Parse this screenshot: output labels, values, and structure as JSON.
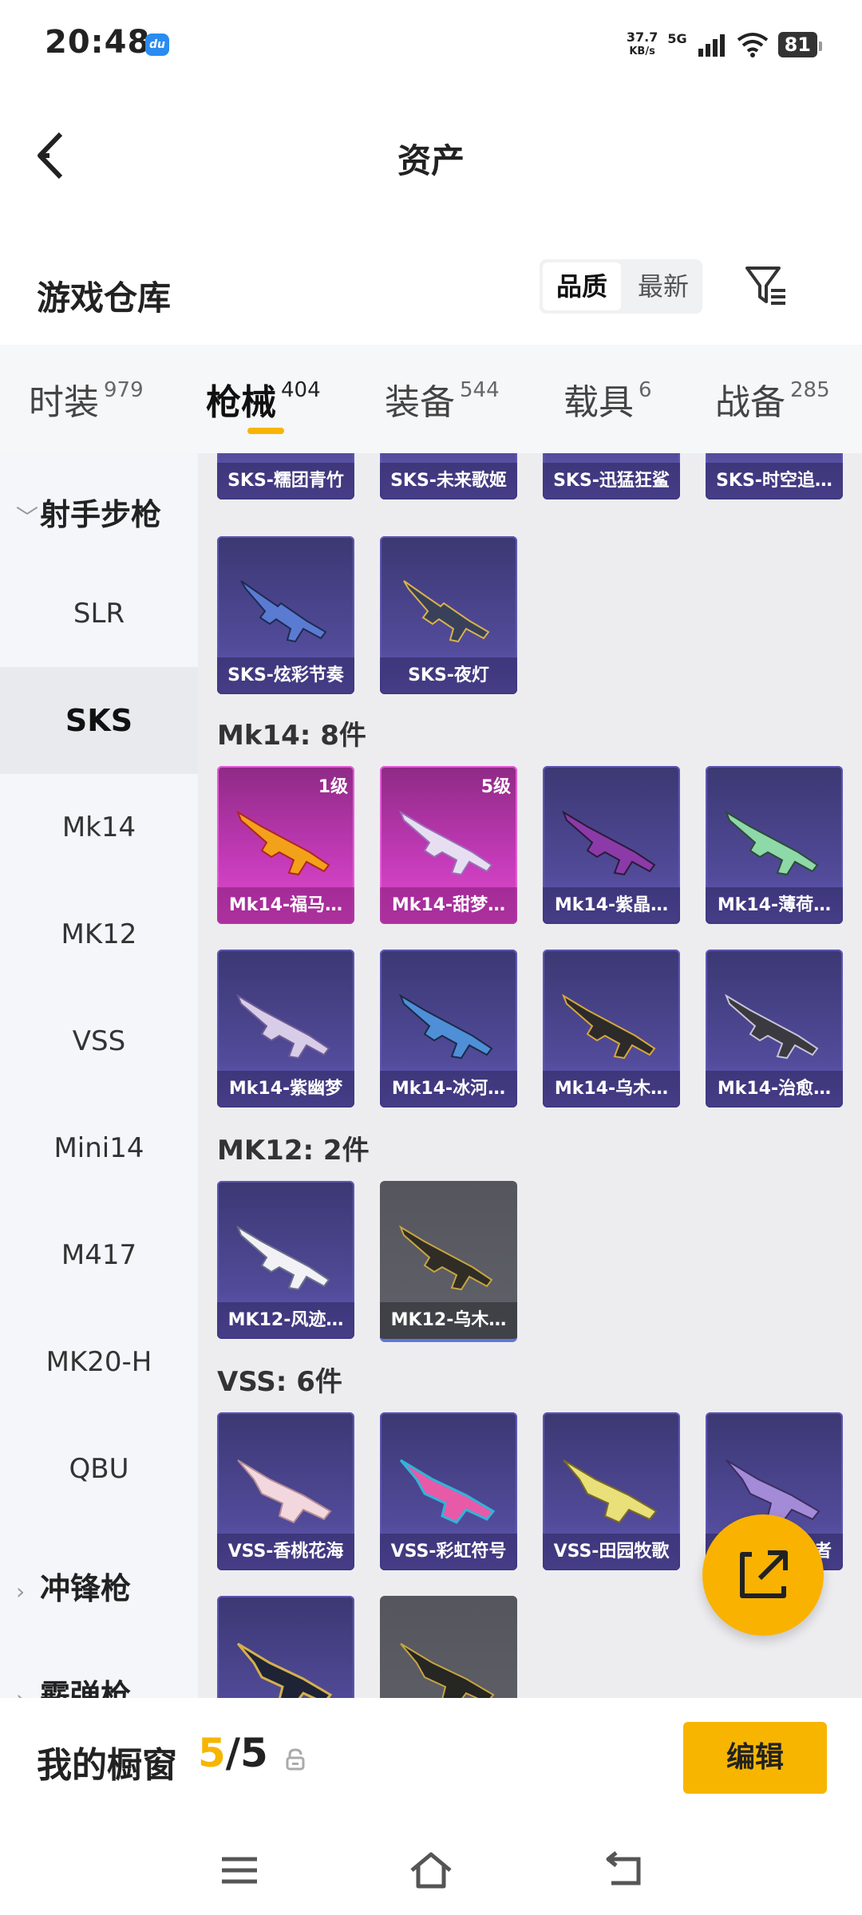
{
  "status_bar": {
    "time": "20:48",
    "app_badge": "du",
    "net_speed_value": "37.7",
    "net_speed_unit": "KB/s",
    "network": "5G",
    "battery": "81"
  },
  "header": {
    "title": "资产"
  },
  "warehouse": {
    "title": "游戏仓库",
    "sort_options": [
      "品质",
      "最新"
    ],
    "sort_selected": "品质"
  },
  "tabs": [
    {
      "label": "时装",
      "count": "979"
    },
    {
      "label": "枪械",
      "count": "404",
      "active": true
    },
    {
      "label": "装备",
      "count": "544"
    },
    {
      "label": "载具",
      "count": "6"
    },
    {
      "label": "战备",
      "count": "285"
    }
  ],
  "sidebar": {
    "group_rifle": "射手步枪",
    "items": [
      "SLR",
      "SKS",
      "Mk14",
      "MK12",
      "VSS",
      "Mini14",
      "M417",
      "MK20-H",
      "QBU"
    ],
    "selected": "SKS",
    "group_smg": "冲锋枪",
    "group_shotgun": "霰弹枪"
  },
  "content": {
    "sks_row1": [
      "SKS-糯团青竹",
      "SKS-未来歌姬",
      "SKS-迅猛狂鲨",
      "SKS-时空追…"
    ],
    "sks_row2": [
      "SKS-炫彩节奏",
      "SKS-夜灯"
    ],
    "mk14_label": "Mk14: 8件",
    "mk14_items": [
      {
        "name": "Mk14-福马…",
        "level": "1级",
        "rarity": "pink"
      },
      {
        "name": "Mk14-甜梦…",
        "level": "5级",
        "rarity": "pink"
      },
      {
        "name": "Mk14-紫晶…",
        "rarity": "purple"
      },
      {
        "name": "Mk14-薄荷…",
        "rarity": "purple"
      },
      {
        "name": "Mk14-紫幽梦",
        "rarity": "purple"
      },
      {
        "name": "Mk14-冰河…",
        "rarity": "purple"
      },
      {
        "name": "Mk14-乌木…",
        "rarity": "purple"
      },
      {
        "name": "Mk14-治愈…",
        "rarity": "purple"
      }
    ],
    "mk12_label": "MK12: 2件",
    "mk12_items": [
      {
        "name": "MK12-风迹…",
        "rarity": "purple"
      },
      {
        "name": "MK12-乌木…",
        "rarity": "gray"
      }
    ],
    "vss_label": "VSS: 6件",
    "vss_items": [
      {
        "name": "VSS-香桃花海",
        "rarity": "purple"
      },
      {
        "name": "VSS-彩虹符号",
        "rarity": "purple"
      },
      {
        "name": "VSS-田园牧歌",
        "rarity": "purple"
      },
      {
        "name": "者",
        "rarity": "purple"
      }
    ]
  },
  "bottom": {
    "label": "我的橱窗",
    "count_current": "5",
    "count_total": "/5",
    "edit_label": "编辑"
  },
  "colors": {
    "accent": "#f7b500",
    "card_purple": "#524b9a",
    "card_pink": "#c43ab8",
    "card_gray": "#5a5b62"
  }
}
